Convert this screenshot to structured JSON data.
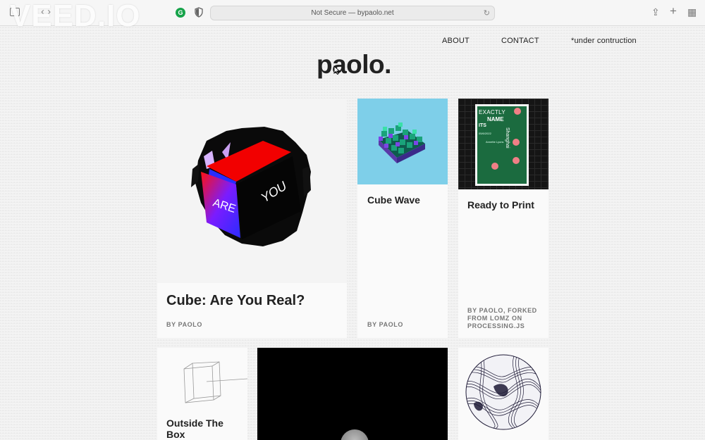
{
  "browser": {
    "url": "Not Secure — bypaolo.net",
    "watermark": "VEED.IO",
    "extension_letter": "G"
  },
  "nav": {
    "about": "ABOUT",
    "contact": "CONTACT",
    "under_construction": "*under contruction"
  },
  "logo": "paolo.",
  "cards": [
    {
      "title": "Cube: Are You Real?",
      "byline": "BY PAOLO",
      "cube_text_a": "ARE",
      "cube_text_b": "YOU"
    },
    {
      "title": "Cube Wave",
      "byline": "BY PAOLO"
    },
    {
      "title": "Ready to Print",
      "byline": "BY PAOLO, FORKED FROM LOMZ ON PROCESSING.JS",
      "poster": {
        "line1": "EXACTLY",
        "line2": "NAME",
        "line3": "ITS",
        "date": "05/6/2022",
        "author": "Annette Lyons",
        "side": "Shanghai"
      }
    },
    {
      "title": "Outside The Box"
    },
    {
      "title": ""
    },
    {
      "title": ""
    }
  ],
  "colors": {
    "accent_red": "#f20000",
    "accent_blue": "#2a2cff",
    "sky": "#7ecfe9",
    "teal": "#1aa37a",
    "poster_green": "#1b6b3f",
    "dot_pink": "#f07f86"
  }
}
